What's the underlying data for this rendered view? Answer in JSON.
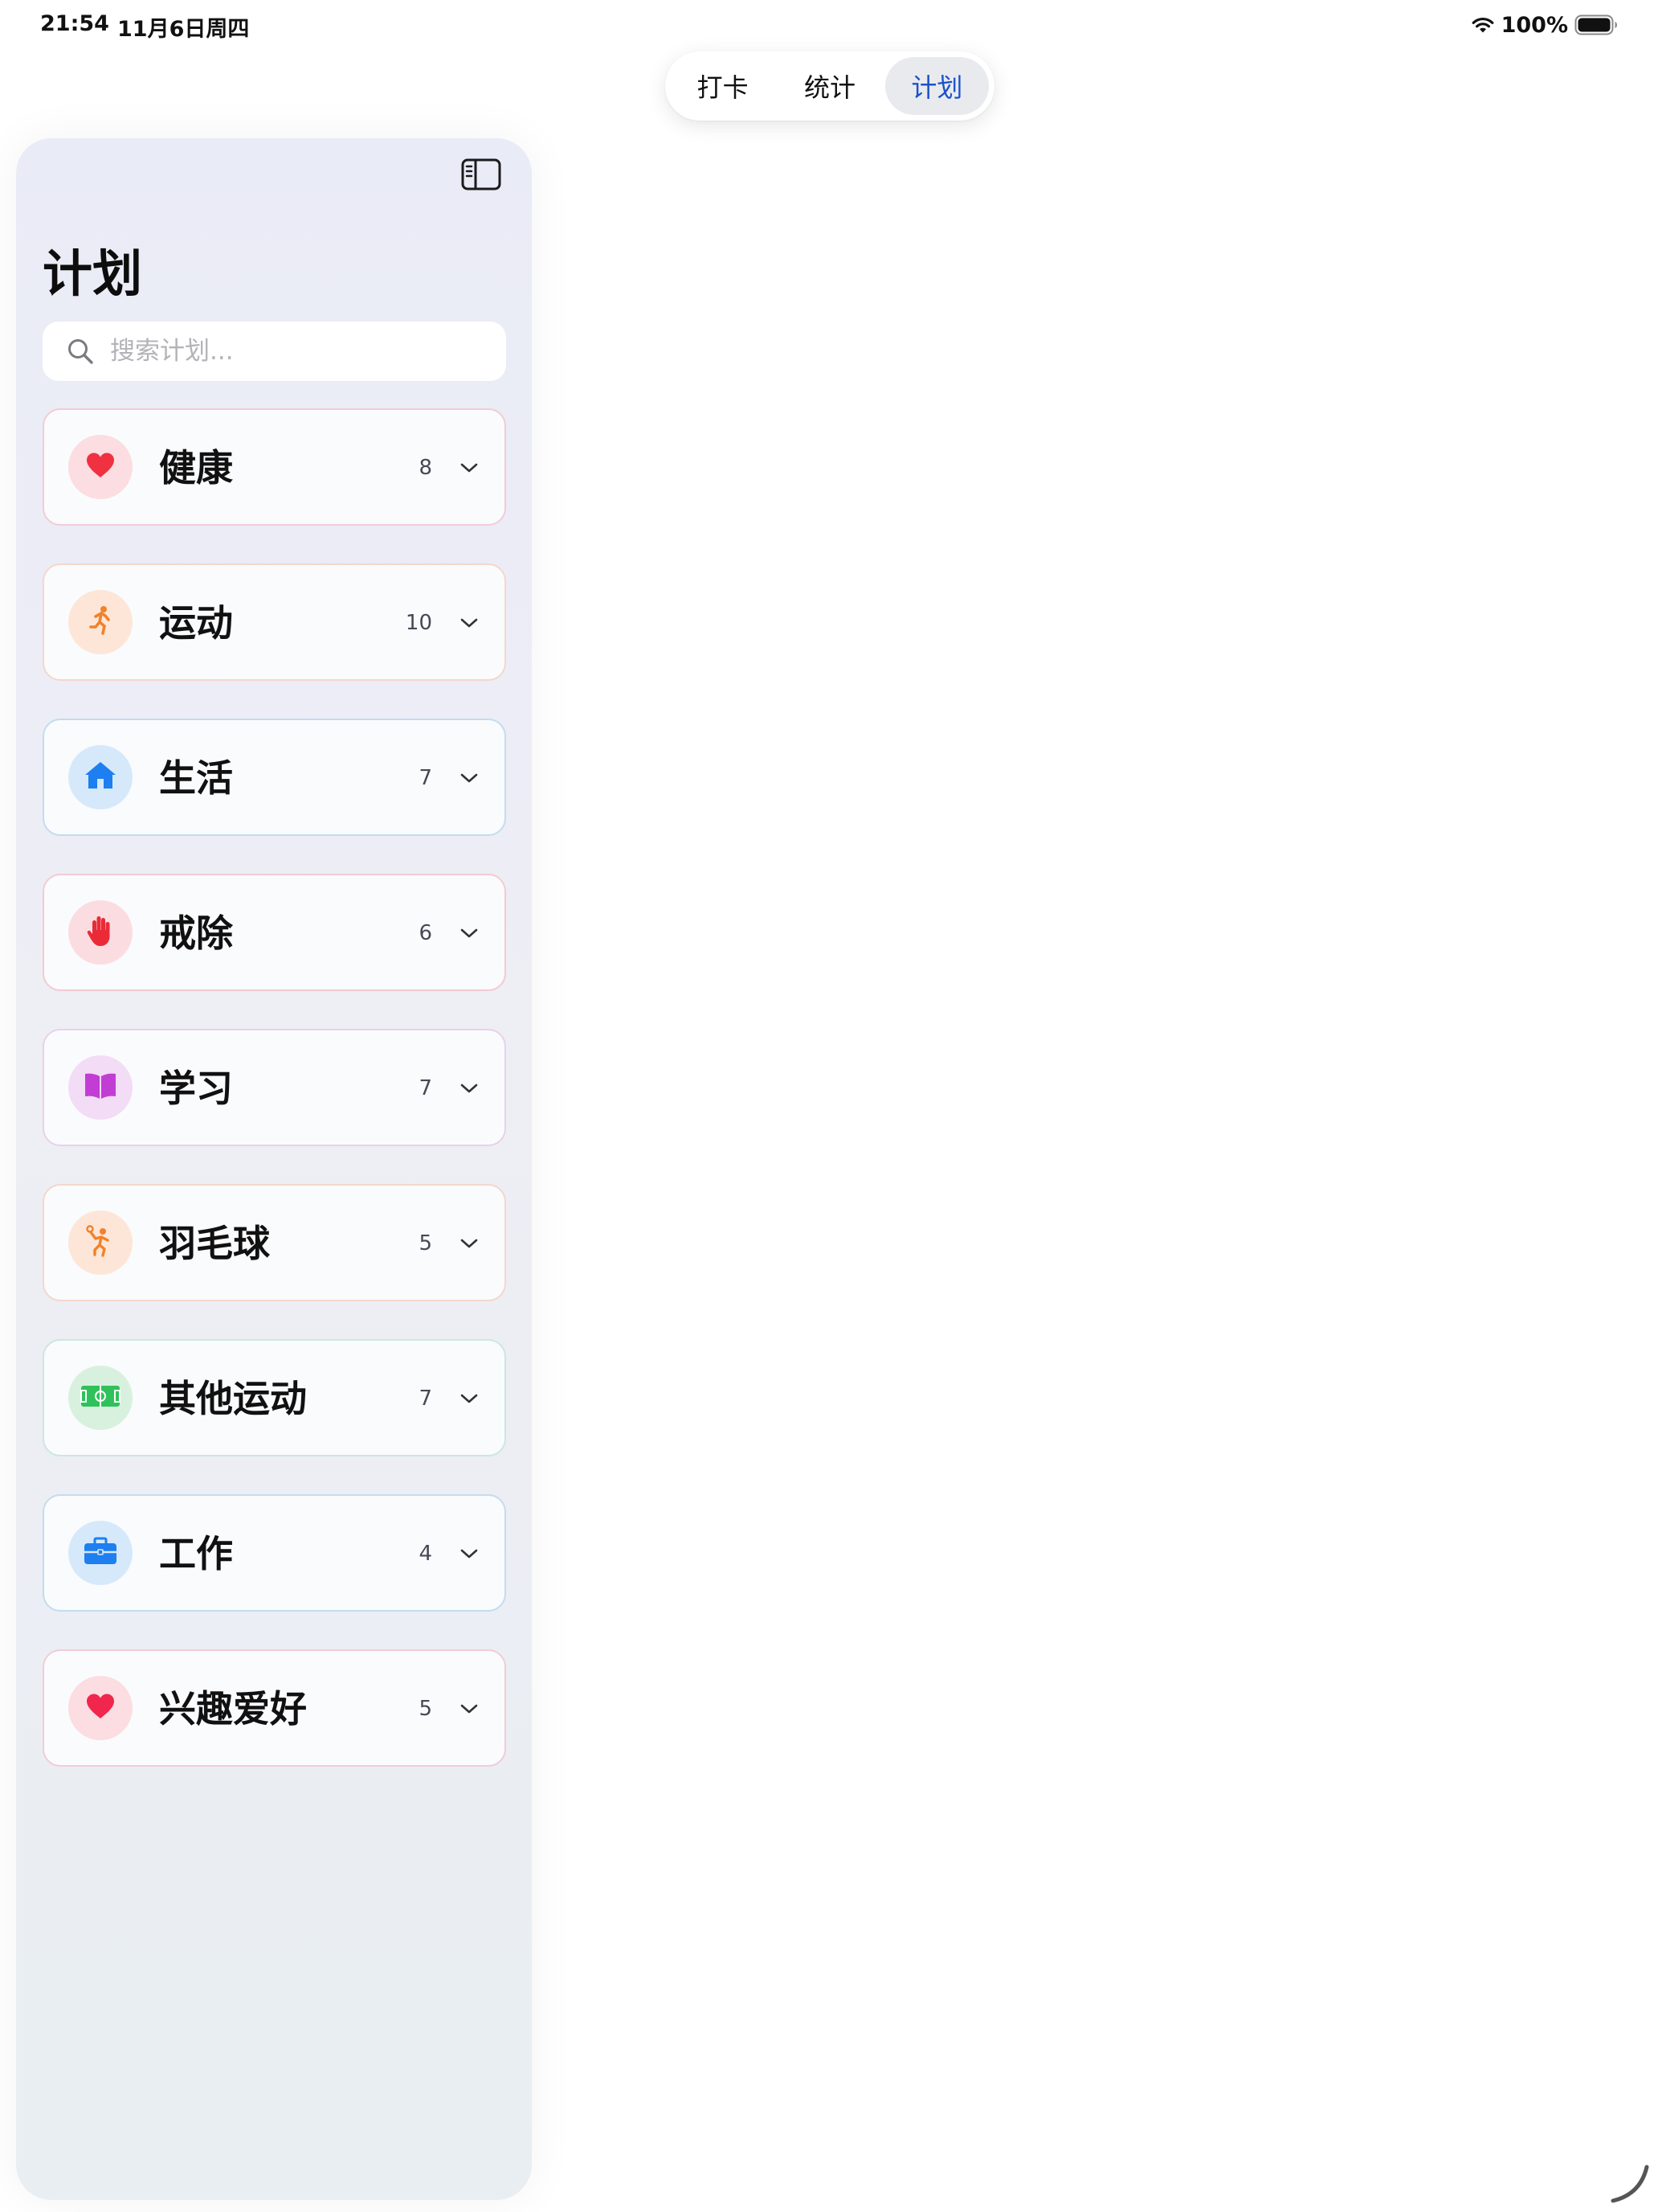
{
  "status_bar": {
    "time": "21:54",
    "date": "11月6日周四",
    "battery_text": "100%",
    "battery_level": 1.0
  },
  "tabs": [
    {
      "label": "打卡",
      "active": false
    },
    {
      "label": "统计",
      "active": false
    },
    {
      "label": "计划",
      "active": true
    }
  ],
  "sidebar": {
    "title": "计划",
    "search_placeholder": "搜索计划...",
    "search_value": "",
    "categories": [
      {
        "name": "健康",
        "count": "8",
        "icon": "heart-icon",
        "icon_color": "#f0313f",
        "icon_bg": "#fcdde1"
      },
      {
        "name": "运动",
        "count": "10",
        "icon": "running-icon",
        "icon_color": "#f0822a",
        "icon_bg": "#fde6d8"
      },
      {
        "name": "生活",
        "count": "7",
        "icon": "house-icon",
        "icon_color": "#1d7ff0",
        "icon_bg": "#d6e9fb"
      },
      {
        "name": "戒除",
        "count": "6",
        "icon": "hand-raised-icon",
        "icon_color": "#ea2b37",
        "icon_bg": "#fbdde1"
      },
      {
        "name": "学习",
        "count": "7",
        "icon": "book-icon",
        "icon_color": "#c23dd4",
        "icon_bg": "#f3dcf6"
      },
      {
        "name": "羽毛球",
        "count": "5",
        "icon": "badminton-icon",
        "icon_color": "#f0822a",
        "icon_bg": "#fde6d8"
      },
      {
        "name": "其他运动",
        "count": "7",
        "icon": "soccer-field-icon",
        "icon_color": "#2fc15a",
        "icon_bg": "#d8f1df"
      },
      {
        "name": "工作",
        "count": "4",
        "icon": "briefcase-icon",
        "icon_color": "#1d7ff0",
        "icon_bg": "#d6e9fb"
      },
      {
        "name": "兴趣爱好",
        "count": "5",
        "icon": "heart-icon",
        "icon_color": "#f0264c",
        "icon_bg": "#fcdde1"
      }
    ]
  },
  "colors": {
    "accent": "#1a52c8",
    "sidebar_bg": "#eceef6"
  }
}
